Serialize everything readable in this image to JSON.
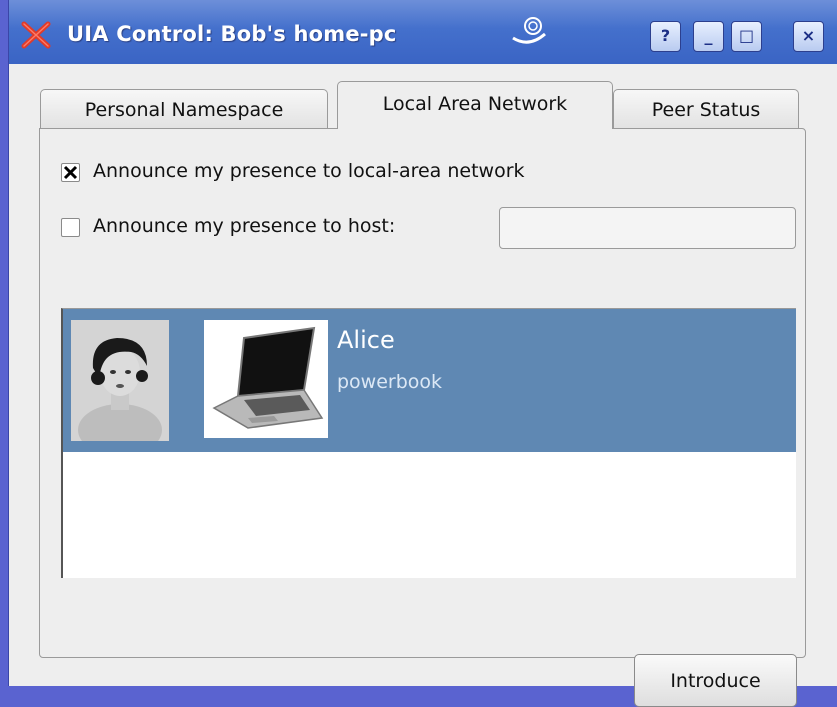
{
  "window": {
    "title": "UIA Control: Bob's home-pc",
    "buttons": {
      "help": "?",
      "minimize": "_",
      "maximize": "□",
      "close": "×"
    }
  },
  "tabs": [
    {
      "label": "Personal Namespace",
      "active": false
    },
    {
      "label": "Local Area Network",
      "active": true
    },
    {
      "label": "Peer Status",
      "active": false
    }
  ],
  "lan": {
    "announce_lan": {
      "label": "Announce my presence to local-area network",
      "checked": true
    },
    "announce_host": {
      "label": "Announce my presence to host:",
      "checked": false
    },
    "host_field": {
      "value": "",
      "placeholder": ""
    }
  },
  "peers": [
    {
      "name": "Alice",
      "device": "powerbook",
      "selected": true
    }
  ],
  "actions": {
    "introduce_label": "Introduce"
  }
}
